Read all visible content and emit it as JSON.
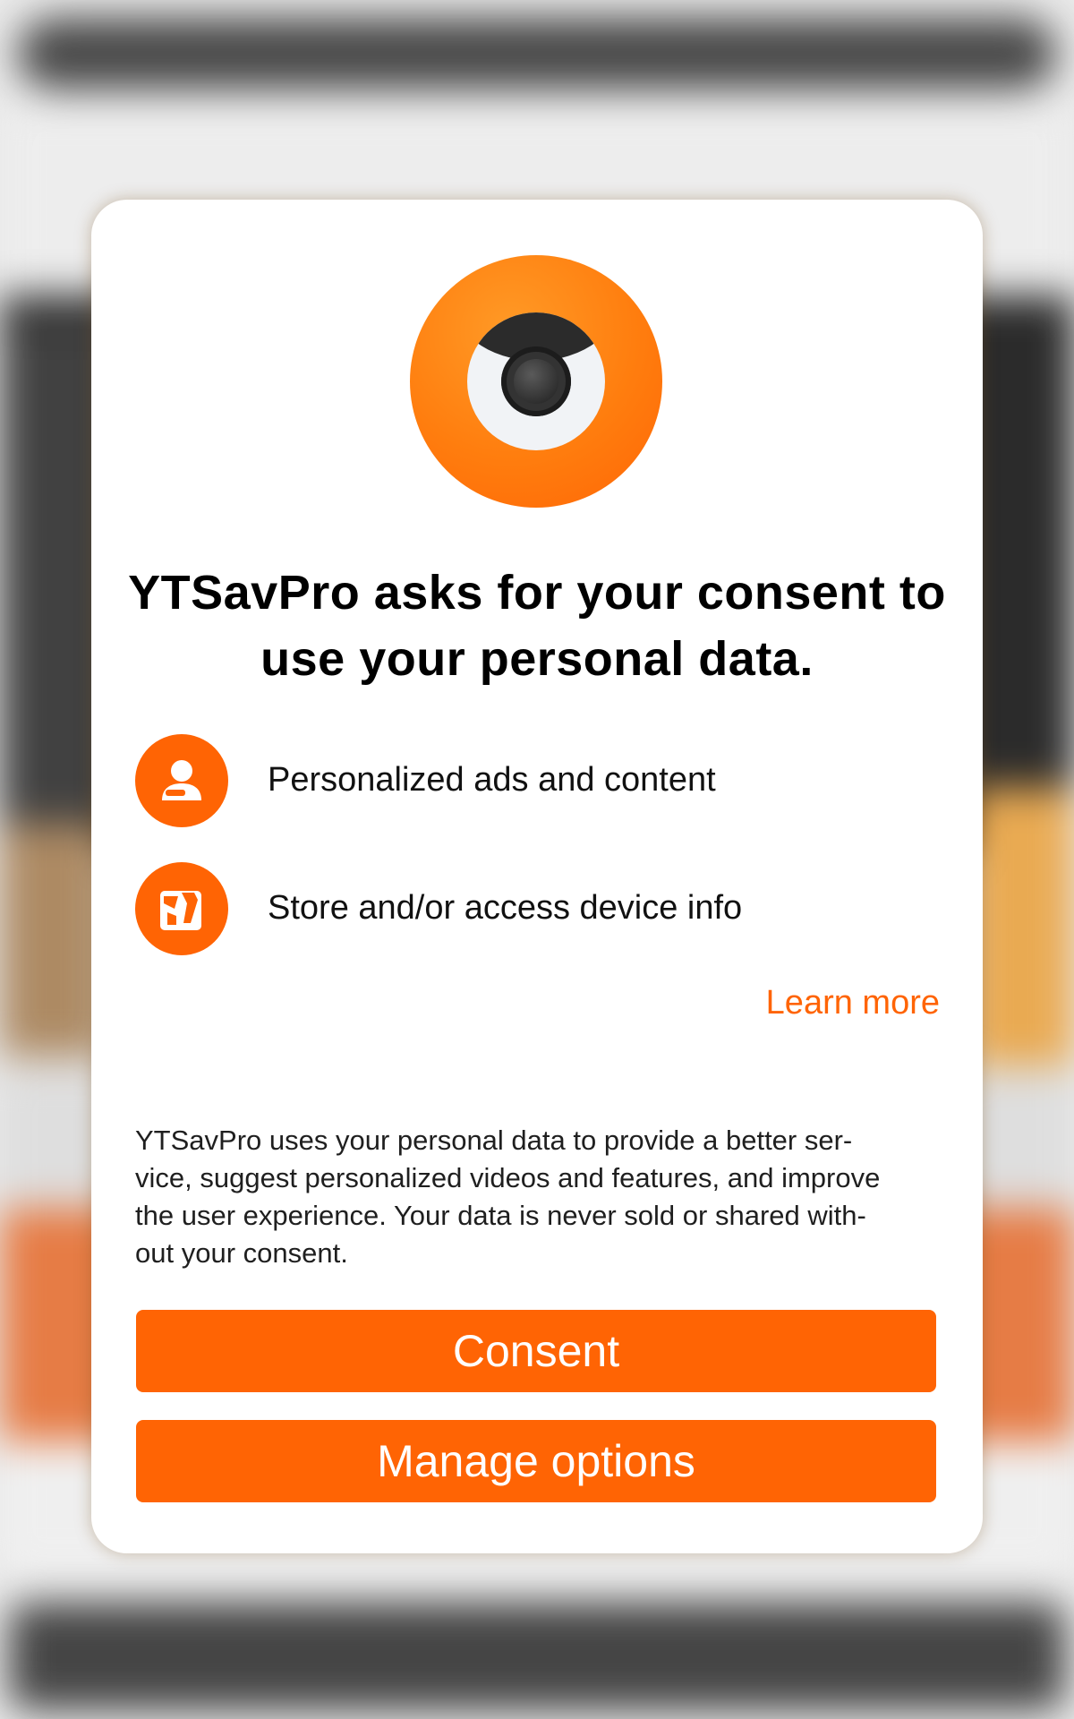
{
  "dialog": {
    "app_logo": "eye-camera-logo",
    "title": "YTSavPro asks for your consent to use your personal data.",
    "purposes": [
      {
        "icon": "person-icon",
        "label": "Personalized ads and content"
      },
      {
        "icon": "device-access-icon",
        "label": "Store and/or access device info"
      }
    ],
    "learn_more": "Learn more",
    "description": "YTSavPro uses your personal data to provide a better ser-vice, suggest personalized videos and features, and improve the user experience. Your data is never sold or shared with-out your consent.",
    "description_lines": [
      "YTSavPro uses your personal data to provide a better ser-",
      "vice, suggest personalized videos and features, and improve",
      "the user experience. Your data is never sold or shared with-",
      "out your consent."
    ],
    "consent_label": "Consent",
    "manage_label": "Manage options"
  },
  "colors": {
    "accent": "#ff6404",
    "logo_orange": "#ff7d0e",
    "dialog_background": "#ffffff",
    "title_text": "#000000"
  }
}
